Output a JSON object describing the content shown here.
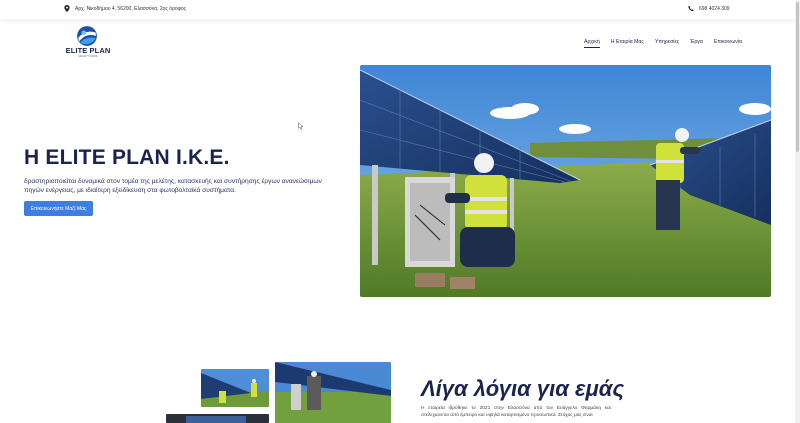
{
  "topbar": {
    "address": "Αρχ. Νικοδήμου 4, 56200, Ελασσόνα, 2ος όροφος",
    "phone": "698 4024 309"
  },
  "logo": {
    "name": "ELITE PLAN",
    "tagline": "QUALITY WORK"
  },
  "nav": {
    "items": [
      "Αρχική",
      "Η Εταιρία Μας",
      "Υπηρεσίες",
      "Έργα",
      "Επικοινωνία"
    ]
  },
  "hero": {
    "title": "Η ELITE PLAN I.K.E.",
    "description": "δραστηριοποιείται δυναμικά στον τομέα της μελέτης, κατασκευής και συντήρησης έργων ανανεώσιμων πηγών ενέργειας, με ιδιαίτερη εξειδίκευση στα φωτοβολταϊκά συστήματα.",
    "button_label": "Επικοινωνήστε Μαζί Μας"
  },
  "about": {
    "title": "Λίγα λόγια για εμάς",
    "text": "Η εταιρεία ιδρύθηκε το 2021 στην Ελασσόνα από τον Ευάγγελο Φαρμάκη και στελεχώνεται από έμπειρο και υψηλά καταρτισμένο προσωπικό. Στόχος μας είναι"
  },
  "colors": {
    "brand_navy": "#1b2350",
    "button_blue": "#3f7de0"
  },
  "icons": {
    "address": "map-pin-icon",
    "phone": "phone-icon"
  }
}
